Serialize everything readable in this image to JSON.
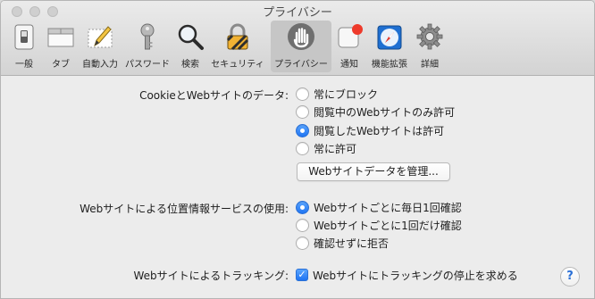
{
  "window": {
    "title": "プライバシー"
  },
  "toolbar": {
    "items": [
      {
        "label": "一般",
        "icon": "general-switch-icon"
      },
      {
        "label": "タブ",
        "icon": "tabs-icon"
      },
      {
        "label": "自動入力",
        "icon": "autofill-pencil-icon"
      },
      {
        "label": "パスワード",
        "icon": "key-icon"
      },
      {
        "label": "検索",
        "icon": "magnifier-icon"
      },
      {
        "label": "セキュリティ",
        "icon": "padlock-icon"
      },
      {
        "label": "プライバシー",
        "icon": "hand-icon",
        "selected": true
      },
      {
        "label": "通知",
        "icon": "notification-badge-icon"
      },
      {
        "label": "機能拡張",
        "icon": "puzzle-compass-icon"
      },
      {
        "label": "詳細",
        "icon": "gear-icon"
      }
    ]
  },
  "cookies": {
    "label": "CookieとWebサイトのデータ:",
    "options": [
      "常にブロック",
      "閲覧中のWebサイトのみ許可",
      "閲覧したWebサイトは許可",
      "常に許可"
    ],
    "selected_index": 2,
    "manage_button": "Webサイトデータを管理..."
  },
  "location": {
    "label": "Webサイトによる位置情報サービスの使用:",
    "options": [
      "Webサイトごとに毎日1回確認",
      "Webサイトごとに1回だけ確認",
      "確認せずに拒否"
    ],
    "selected_index": 0
  },
  "tracking": {
    "label": "Webサイトによるトラッキング:",
    "checkbox_label": "Webサイトにトラッキングの停止を求める",
    "checked": true
  },
  "help": {
    "glyph": "?"
  },
  "colors": {
    "accent": "#1f74f2",
    "background": "#ececec",
    "selected_tab": "#c6c6c6"
  }
}
